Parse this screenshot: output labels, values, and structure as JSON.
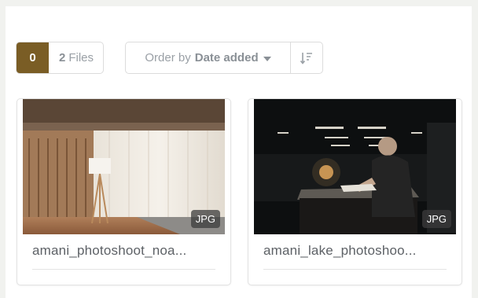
{
  "toolbar": {
    "selected_count": "0",
    "files_count": "2",
    "files_label": "Files",
    "order_prefix": "Order by",
    "order_value": "Date added"
  },
  "files": [
    {
      "name": "amani_photoshoot_noa...",
      "type_badge": "JPG"
    },
    {
      "name": "amani_lake_photoshoo...",
      "type_badge": "JPG"
    }
  ],
  "colors": {
    "accent": "#7a5d25",
    "muted_text": "#9aa0a6",
    "border": "#dcdcdc"
  },
  "icons": {
    "sort": "sort-order-icon",
    "dropdown": "chevron-down-icon"
  }
}
